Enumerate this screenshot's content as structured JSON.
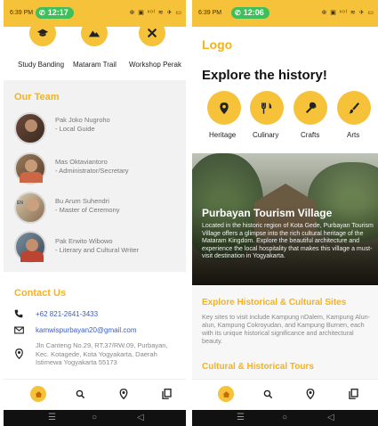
{
  "left": {
    "status": {
      "time": "6:39 PM",
      "call": "12:17",
      "icons": "⊕ ▣ ᵛᵒˡ ≋ ✈ ▭"
    },
    "categories": [
      {
        "label": "Study Banding",
        "icon": "graduation-cap-icon"
      },
      {
        "label": "Mataram Trail",
        "icon": "mountain-icon"
      },
      {
        "label": "Workshop Perak",
        "icon": "tools-icon"
      }
    ],
    "team_title": "Our Team",
    "team": [
      {
        "name": "Pak Joko Nugroho",
        "role": "- Local Guide"
      },
      {
        "name": "Mas Oktaviantoro",
        "role": "- Administrator/Secretary"
      },
      {
        "name": "Bu Arum Suhendri",
        "role": "- Master of Ceremony"
      },
      {
        "name": "Pak Erwito Wibowo",
        "role": "- Literary and Cultural Writer"
      }
    ],
    "contact_title": "Contact Us",
    "phone": "+62 821-2641-3433",
    "email": "kamwispurbayan20@gmail.com",
    "address": "Jln Canteng No.29, RT.37/RW.09, Purbayan, Kec. Kotagede, Kota Yogyakarta, Daerah Istimewa Yogyakarta 55173"
  },
  "right": {
    "status": {
      "time": "6:39 PM",
      "call": "12:06",
      "icons": "⊕ ▣ ᵛᵒˡ ≋ ✈ ▭"
    },
    "logo": "Logo",
    "heading": "Explore the history!",
    "categories": [
      {
        "label": "Heritage",
        "icon": "location-pin-icon"
      },
      {
        "label": "Culinary",
        "icon": "fork-knife-icon"
      },
      {
        "label": "Crafts",
        "icon": "wrench-icon"
      },
      {
        "label": "Arts",
        "icon": "brush-icon"
      }
    ],
    "hero_title": "Purbayan Tourism Village",
    "hero_text": "Located in the historic region of Kota Gede, Purbayan Tourism Village offers a glimpse into the rich cultural heritage of the Mataram Kingdom. Explore the beautiful architecture and experience the local hospitality that makes this village a must-visit destination in Yogyakarta.",
    "section1_title": "Explore Historical & Cultural Sites",
    "section1_text": "Key sites to visit include Kampung nDalem, Kampung Alun-alun, Kampung Cokroyudan, and Kampung Burnen, each with its unique historical significance and architectural beauty.",
    "section2_title": "Cultural & Historical Tours"
  },
  "colors": {
    "accent": "#f6c23a",
    "accent_text": "#f6b21a",
    "call_pill": "#3fbf5a"
  }
}
